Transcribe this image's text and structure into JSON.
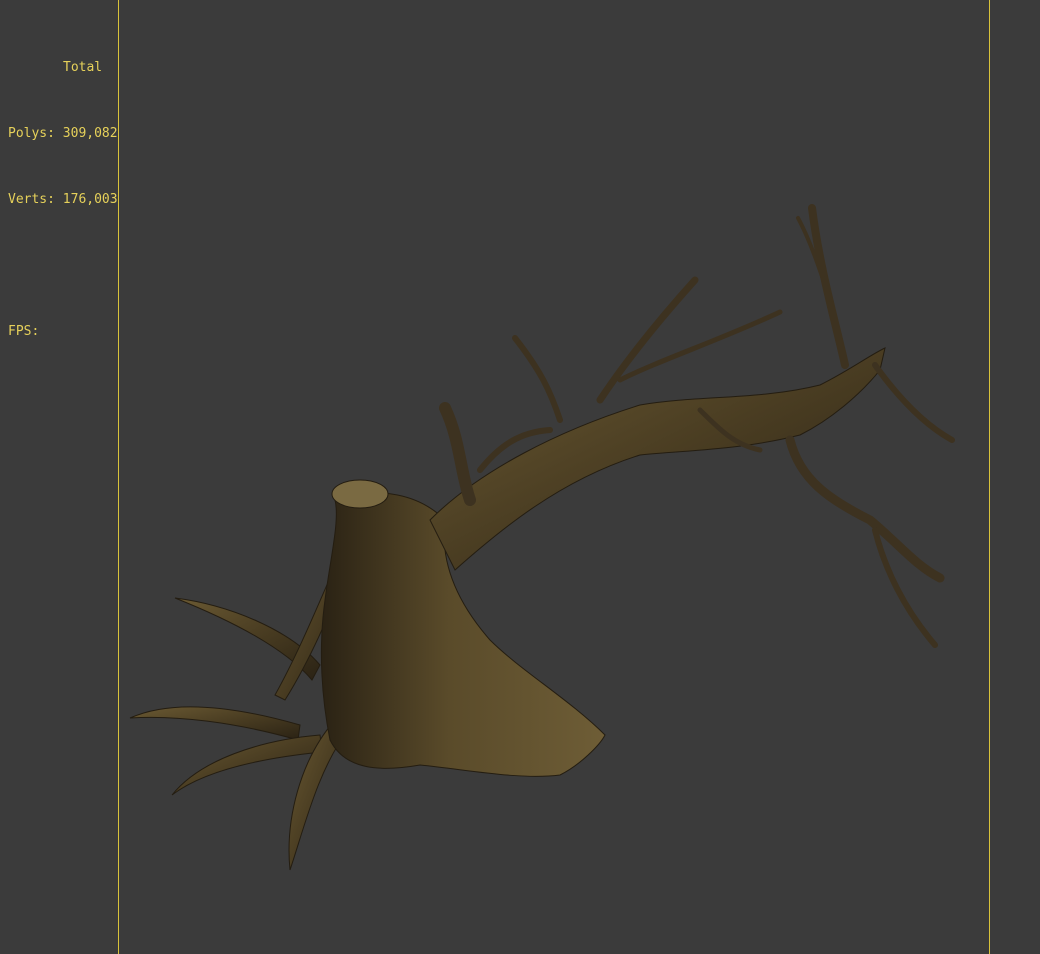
{
  "viewport": {
    "background_color": "#3b3b3b",
    "frame_color": "#d8c23a",
    "stats_color": "#e6d15a",
    "stats": {
      "title": "Total",
      "polys_label": "Polys:",
      "polys_value": "309,082",
      "verts_label": "Verts:",
      "verts_value": "176,003",
      "fps_label": "FPS:",
      "fps_value": ""
    },
    "model": {
      "name_icon": "dead-tree-model",
      "bark_color": "#4a3d22",
      "bark_highlight": "#6b5a33",
      "bark_shadow": "#2a2214"
    }
  }
}
